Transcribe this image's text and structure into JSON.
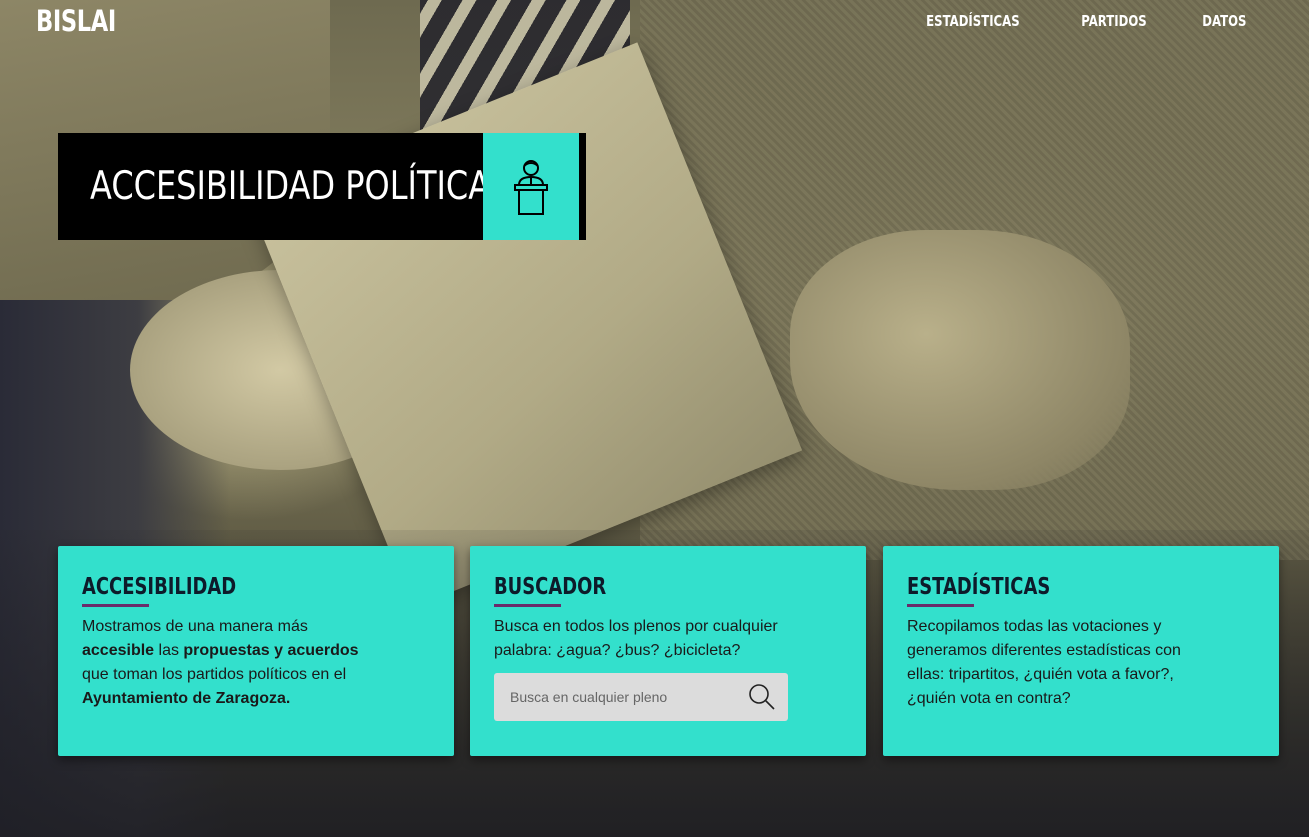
{
  "nav": {
    "logo": "BISLAI",
    "links": [
      "ESTADÍSTICAS",
      "PARTIDOS",
      "DATOS"
    ]
  },
  "hero": {
    "title": "ACCESIBILIDAD POLÍTICA",
    "icon": "speaker-podium-icon",
    "accent_color": "#33e0cc"
  },
  "cards": [
    {
      "title": "ACCESIBILIDAD",
      "text_parts": [
        {
          "t": "Mostramos de una manera más ",
          "bold": false
        },
        {
          "t": "accesible",
          "bold": true
        },
        {
          "t": " las ",
          "bold": false
        },
        {
          "t": "propuestas y acuerdos",
          "bold": true
        },
        {
          "t": " que toman los partidos políticos en el ",
          "bold": false
        },
        {
          "t": "Ayuntamiento de Zaragoza.",
          "bold": true
        }
      ]
    },
    {
      "title": "BUSCADOR",
      "text": "Busca en todos los plenos por cualquier palabra: ¿agua? ¿bus? ¿bicicleta?",
      "search_placeholder": "Busca en cualquier pleno",
      "search_value": ""
    },
    {
      "title": "ESTADÍSTICAS",
      "text": "Recopilamos todas las votaciones y generamos diferentes estadísticas con ellas: tripartitos, ¿quién vota a favor?, ¿quién vota en contra?"
    }
  ],
  "colors": {
    "card_bg": "#33e0cc",
    "underline": "#6a2c6b",
    "banner_bg": "#000000"
  }
}
